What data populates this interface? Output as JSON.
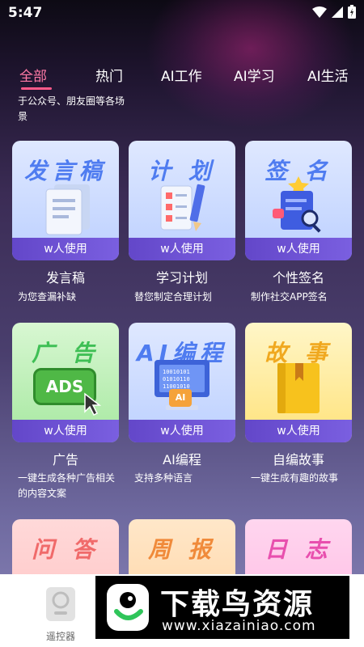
{
  "status": {
    "time": "5:47"
  },
  "tabs": [
    {
      "label": "全部"
    },
    {
      "label": "热门"
    },
    {
      "label": "AI工作"
    },
    {
      "label": "AI学习"
    },
    {
      "label": "AI生活"
    }
  ],
  "description": "于公众号、朋友圈等各场景",
  "cards": [
    {
      "art": "发言稿",
      "users": "w人使用",
      "title": "发言稿",
      "subtitle": "为您查漏补缺"
    },
    {
      "art": "计 划",
      "users": "w人使用",
      "title": "学习计划",
      "subtitle": "替您制定合理计划"
    },
    {
      "art": "签 名",
      "users": "w人使用",
      "title": "个性签名",
      "subtitle": "制作社交APP签名"
    },
    {
      "art": "广 告",
      "users": "w人使用",
      "title": "广告",
      "subtitle": "一键生成各种广告相关的内容文案",
      "badge": "ADS"
    },
    {
      "art": "AI编程",
      "users": "w人使用",
      "title": "AI编程",
      "subtitle": "支持多种语言",
      "screen": "AI"
    },
    {
      "art": "故 事",
      "users": "w人使用",
      "title": "自编故事",
      "subtitle": "一键生成有趣的故事"
    },
    {
      "art": "问 答"
    },
    {
      "art": "周 报"
    },
    {
      "art": "日 志"
    }
  ],
  "bottom": {
    "remote_label": "遥控器"
  },
  "watermark": {
    "title": "下载鸟资源",
    "url": "www.xiazainiao.com"
  }
}
